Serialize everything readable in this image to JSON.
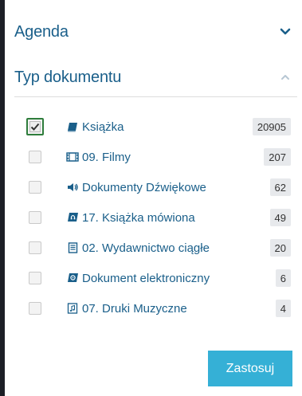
{
  "agenda": {
    "title": "Agenda",
    "icon": "chevron-down-icon"
  },
  "doc_type": {
    "title": "Typ dokumentu",
    "icon": "chevron-up-icon"
  },
  "filters": [
    {
      "label": "Książka",
      "count": "20905",
      "checked": true,
      "icon": "book-icon"
    },
    {
      "label": "09. Filmy",
      "count": "207",
      "checked": false,
      "icon": "film-icon"
    },
    {
      "label": "Dokumenty Dźwiękowe",
      "count": "62",
      "checked": false,
      "icon": "speaker-icon"
    },
    {
      "label": "17. Książka mówiona",
      "count": "49",
      "checked": false,
      "icon": "audiobook-icon"
    },
    {
      "label": "02. Wydawnictwo ciągłe",
      "count": "20",
      "checked": false,
      "icon": "periodical-icon"
    },
    {
      "label": "Dokument elektroniczny",
      "count": "6",
      "checked": false,
      "icon": "ebook-icon"
    },
    {
      "label": "07. Druki Muzyczne",
      "count": "4",
      "checked": false,
      "icon": "sheet-music-icon"
    }
  ],
  "apply_label": "Zastosuj",
  "colors": {
    "link": "#1a5f8a",
    "accent": "#35b0d6",
    "checked_border": "#2f7d3c",
    "badge": "#e7e9ec"
  }
}
